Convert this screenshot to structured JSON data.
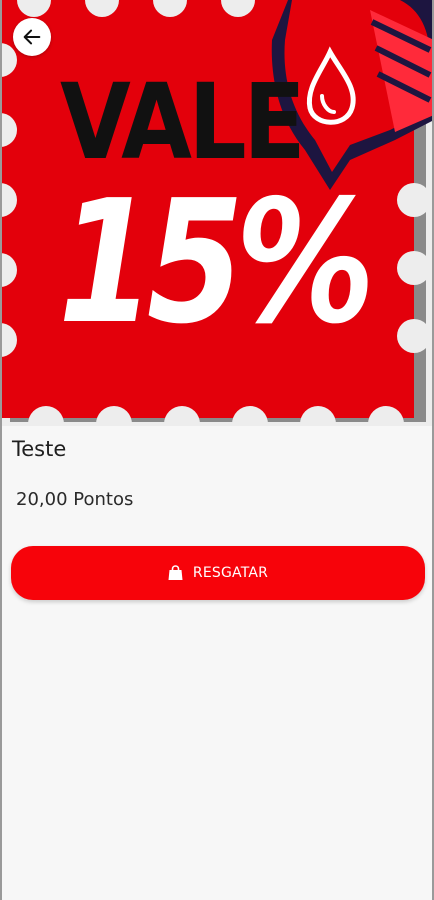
{
  "hero": {
    "headline": "VALE",
    "value": "15%"
  },
  "product": {
    "name": "Teste",
    "points": "20,00 Pontos"
  },
  "actions": {
    "redeem_label": "RESGATAR"
  },
  "colors": {
    "stamp_red": "#e3000b",
    "button_red": "#f7030a",
    "badge_navy": "#1d1540"
  },
  "icons": {
    "back": "arrow-left-icon",
    "redeem": "shopping-bag-icon",
    "badge": "drop-mailbox-icon"
  }
}
